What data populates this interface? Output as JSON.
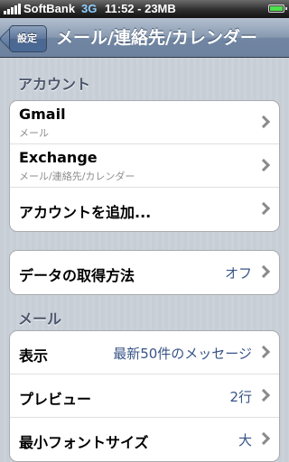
{
  "status_bar": {
    "carrier": "SoftBank",
    "network": "3G",
    "time_storage": "11:52 - 23MB"
  },
  "nav_bar": {
    "back_label": "設定",
    "title": "メール/連絡先/カレンダー"
  },
  "accounts": {
    "header": "アカウント",
    "items": [
      {
        "title": "Gmail",
        "subtitle": "メール"
      },
      {
        "title": "Exchange",
        "subtitle": "メール/連絡先/カレンダー"
      },
      {
        "title": "アカウントを追加..."
      }
    ]
  },
  "fetch": {
    "label": "データの取得方法",
    "value": "オフ"
  },
  "mail": {
    "header": "メール",
    "items": [
      {
        "label": "表示",
        "value": "最新50件のメッセージ"
      },
      {
        "label": "プレビュー",
        "value": "2行"
      },
      {
        "label": "最小フォントサイズ",
        "value": "大"
      }
    ]
  },
  "colors": {
    "nav_blue": "#6d82a0",
    "value_blue": "#385487",
    "background": "#c5ccd4"
  },
  "icons": [
    "signal-icon",
    "battery-icon",
    "chevron-right-icon"
  ]
}
